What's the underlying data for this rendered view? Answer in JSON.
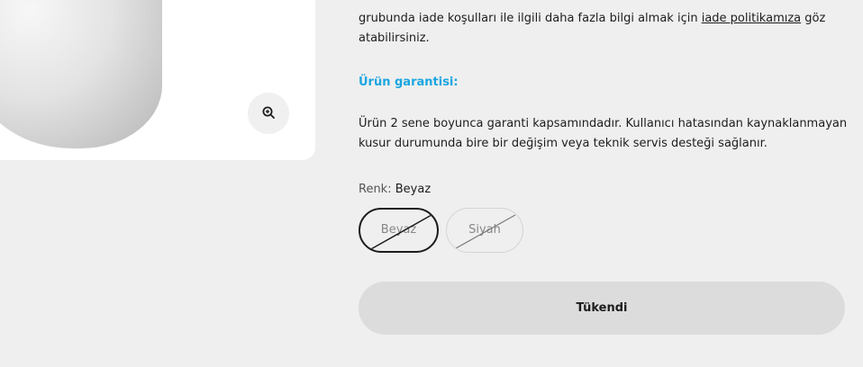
{
  "product": {
    "zoom_icon": "zoom-in-icon"
  },
  "returns": {
    "line_top": "",
    "text_before_link": "grubunda iade koşulları ile ilgili daha fazla bilgi almak için ",
    "link_label": "iade politikamıza",
    "text_after_link": " göz atabilirsiniz."
  },
  "warranty": {
    "title": "Ürün garantisi:",
    "text": "Ürün 2 sene boyunca garanti kapsamındadır. Kullanıcı hatasından kaynaklanmayan kusur durumunda bire bir değişim veya teknik servis desteği sağlanır."
  },
  "color": {
    "label": "Renk:",
    "selected": "Beyaz",
    "options": [
      "Beyaz",
      "Siyah"
    ]
  },
  "cta": {
    "label": "Tükendi"
  }
}
